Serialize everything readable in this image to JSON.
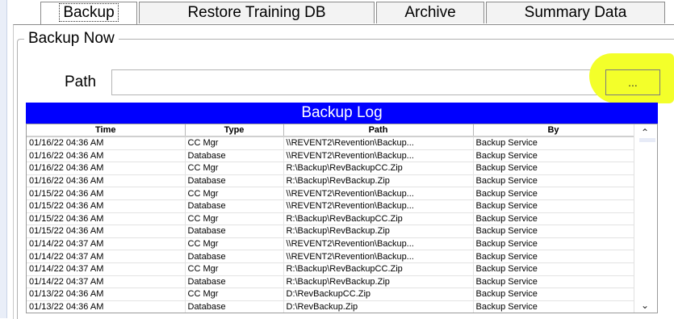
{
  "tabs": [
    {
      "label": "Backup",
      "active": true
    },
    {
      "label": "Restore Training DB",
      "active": false
    },
    {
      "label": "Archive",
      "active": false
    },
    {
      "label": "Summary Data",
      "active": false
    }
  ],
  "backup_now": {
    "group_title": "Backup Now",
    "path_label": "Path",
    "path_value": "",
    "browse_label": "..."
  },
  "log": {
    "title": "Backup Log",
    "columns": [
      "Time",
      "Type",
      "Path",
      "By"
    ],
    "rows": [
      [
        "01/16/22 04:36 AM",
        "CC Mgr",
        "\\\\REVENT2\\Revention\\Backup...",
        "Backup Service"
      ],
      [
        "01/16/22 04:36 AM",
        "Database",
        "\\\\REVENT2\\Revention\\Backup...",
        "Backup Service"
      ],
      [
        "01/16/22 04:36 AM",
        "CC Mgr",
        "R:\\Backup\\RevBackupCC.Zip",
        "Backup Service"
      ],
      [
        "01/16/22 04:36 AM",
        "Database",
        "R:\\Backup\\RevBackup.Zip",
        "Backup Service"
      ],
      [
        "01/15/22 04:36 AM",
        "CC Mgr",
        "\\\\REVENT2\\Revention\\Backup...",
        "Backup Service"
      ],
      [
        "01/15/22 04:36 AM",
        "Database",
        "\\\\REVENT2\\Revention\\Backup...",
        "Backup Service"
      ],
      [
        "01/15/22 04:36 AM",
        "CC Mgr",
        "R:\\Backup\\RevBackupCC.Zip",
        "Backup Service"
      ],
      [
        "01/15/22 04:36 AM",
        "Database",
        "R:\\Backup\\RevBackup.Zip",
        "Backup Service"
      ],
      [
        "01/14/22 04:37 AM",
        "CC Mgr",
        "\\\\REVENT2\\Revention\\Backup...",
        "Backup Service"
      ],
      [
        "01/14/22 04:37 AM",
        "Database",
        "\\\\REVENT2\\Revention\\Backup...",
        "Backup Service"
      ],
      [
        "01/14/22 04:37 AM",
        "CC Mgr",
        "R:\\Backup\\RevBackupCC.Zip",
        "Backup Service"
      ],
      [
        "01/14/22 04:37 AM",
        "Database",
        "R:\\Backup\\RevBackup.Zip",
        "Backup Service"
      ],
      [
        "01/13/22 04:36 AM",
        "CC Mgr",
        "D:\\RevBackupCC.Zip",
        "Backup Service"
      ],
      [
        "01/13/22 04:36 AM",
        "Database",
        "D:\\RevBackup.Zip",
        "Backup Service"
      ]
    ]
  },
  "scrollbar": {
    "up_icon": "chevron-up-icon",
    "down_icon": "chevron-down-icon"
  },
  "colors": {
    "log_header": "#0000ff",
    "highlight": "#f3ff2a"
  }
}
